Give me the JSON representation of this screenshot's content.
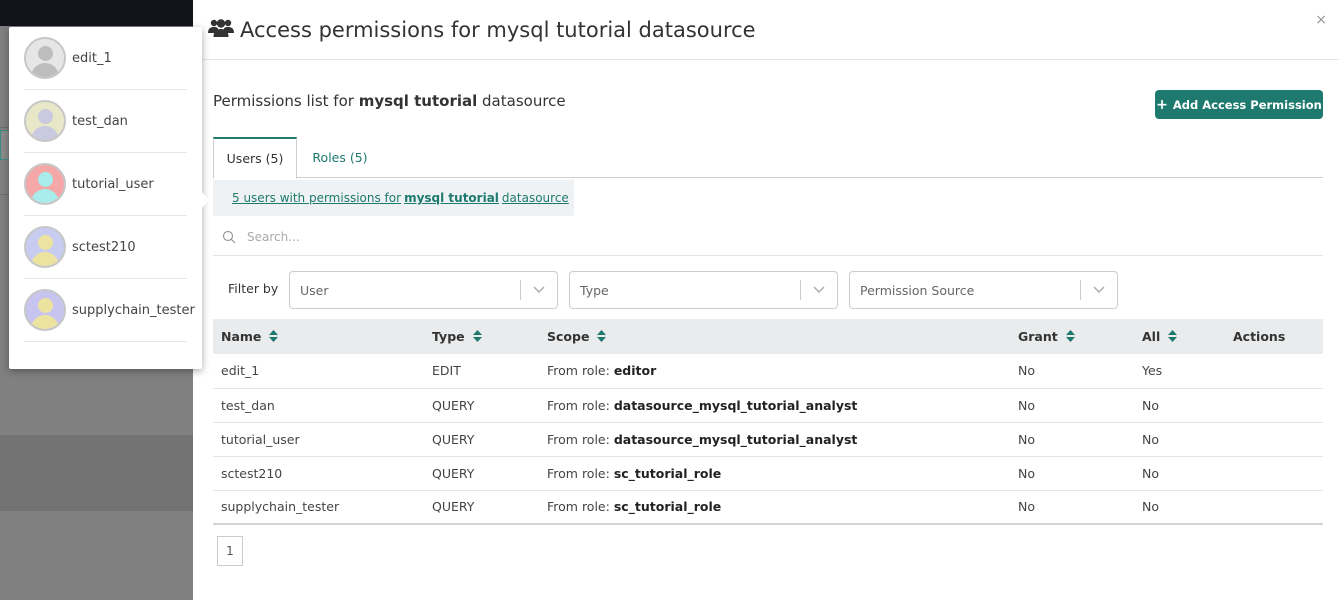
{
  "users_popup": {
    "items": [
      {
        "name": "edit_1",
        "avatar_color": "#e6e6e6",
        "avatar_fg": "#bdbdbd"
      },
      {
        "name": "test_dan",
        "avatar_color": "#e8e8c8",
        "avatar_fg": "#c9c9df"
      },
      {
        "name": "tutorial_user",
        "avatar_color": "#f4a8a8",
        "avatar_fg": "#a8ecec"
      },
      {
        "name": "sctest210",
        "avatar_color": "#c8ccf0",
        "avatar_fg": "#ece3a0"
      },
      {
        "name": "supplychain_tester",
        "avatar_color": "#c8c4f0",
        "avatar_fg": "#ece3a0"
      }
    ]
  },
  "modal": {
    "title": "Access permissions for mysql tutorial datasource",
    "close_label": "×",
    "subhead_prefix": "Permissions list for ",
    "subhead_bold": "mysql tutorial",
    "subhead_suffix": " datasource",
    "add_button": "Add Access Permission",
    "add_icon": "+",
    "tabs": [
      {
        "label": "Users (5)",
        "active": true
      },
      {
        "label": "Roles (5)",
        "active": false
      }
    ],
    "banner_prefix": "5 users with permissions for ",
    "banner_bold": "mysql tutorial",
    "banner_suffix": " datasource",
    "search_placeholder": "Search...",
    "filter_label": "Filter by",
    "filters": [
      "User",
      "Type",
      "Permission Source"
    ],
    "table": {
      "headers": [
        "Name",
        "Type",
        "Scope",
        "Grant",
        "All",
        "Actions"
      ],
      "rows": [
        {
          "name": "edit_1",
          "type": "EDIT",
          "scope_prefix": "From role: ",
          "scope_role": "editor",
          "grant": "No",
          "all": "Yes"
        },
        {
          "name": "test_dan",
          "type": "QUERY",
          "scope_prefix": "From role: ",
          "scope_role": "datasource_mysql_tutorial_analyst",
          "grant": "No",
          "all": "No"
        },
        {
          "name": "tutorial_user",
          "type": "QUERY",
          "scope_prefix": "From role: ",
          "scope_role": "datasource_mysql_tutorial_analyst",
          "grant": "No",
          "all": "No"
        },
        {
          "name": "sctest210",
          "type": "QUERY",
          "scope_prefix": "From role: ",
          "scope_role": "sc_tutorial_role",
          "grant": "No",
          "all": "No"
        },
        {
          "name": "supplychain_tester",
          "type": "QUERY",
          "scope_prefix": "From role: ",
          "scope_role": "sc_tutorial_role",
          "grant": "No",
          "all": "No"
        }
      ]
    },
    "pagination": {
      "current_page": "1"
    },
    "colors": {
      "accent": "#1e7a6e"
    }
  }
}
